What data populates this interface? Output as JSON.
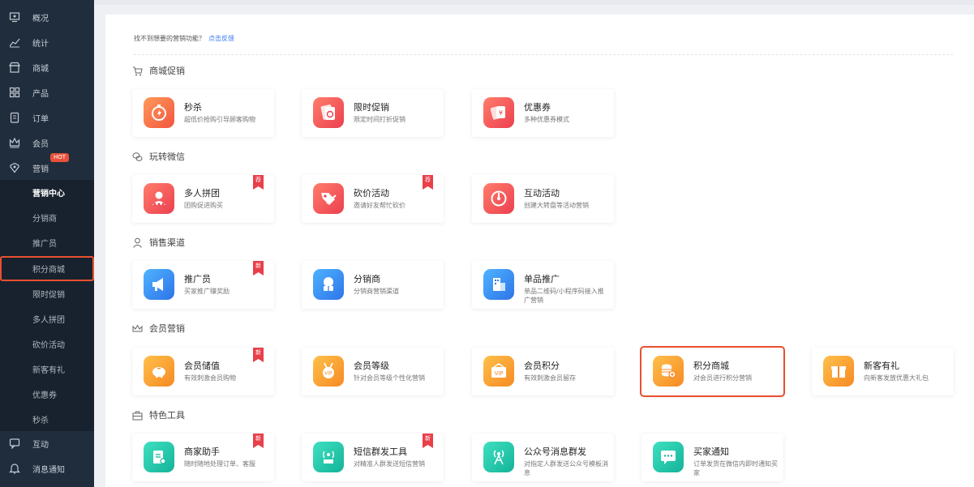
{
  "sidebar": {
    "items": [
      {
        "label": "概况",
        "icon": "dashboard-icon"
      },
      {
        "label": "统计",
        "icon": "chart-icon"
      },
      {
        "label": "商城",
        "icon": "store-icon"
      },
      {
        "label": "产品",
        "icon": "grid-icon"
      },
      {
        "label": "订单",
        "icon": "order-icon"
      },
      {
        "label": "会员",
        "icon": "crown-icon"
      },
      {
        "label": "营销",
        "icon": "marketing-icon"
      }
    ],
    "hot_badge": "HOT",
    "sub_items": [
      {
        "label": "营销中心"
      },
      {
        "label": "分销商"
      },
      {
        "label": "推广员"
      },
      {
        "label": "积分商城"
      },
      {
        "label": "限时促销"
      },
      {
        "label": "多人拼团"
      },
      {
        "label": "砍价活动"
      },
      {
        "label": "新客有礼"
      },
      {
        "label": "优惠券"
      },
      {
        "label": "秒杀"
      }
    ],
    "bottom_items": [
      {
        "label": "互动",
        "icon": "chat-icon"
      },
      {
        "label": "消息通知",
        "icon": "bell-icon"
      }
    ]
  },
  "feedback": {
    "text": "找不到想要的营销功能？",
    "link": "点击反馈"
  },
  "sections": [
    {
      "title": "商城促销",
      "cards": [
        {
          "title": "秒杀",
          "desc": "超低价抢购引导顾客购物"
        },
        {
          "title": "限时促销",
          "desc": "限定时间打折促销"
        },
        {
          "title": "优惠券",
          "desc": "多种优惠券模式"
        }
      ]
    },
    {
      "title": "玩转微信",
      "cards": [
        {
          "title": "多人拼团",
          "desc": "团购促进购买",
          "badge": "荐"
        },
        {
          "title": "砍价活动",
          "desc": "邀请好友帮忙砍价",
          "badge": "荐"
        },
        {
          "title": "互动活动",
          "desc": "创建大转盘等活动营销"
        }
      ]
    },
    {
      "title": "销售渠道",
      "cards": [
        {
          "title": "推广员",
          "desc": "买家推广赚奖励",
          "badge": "新"
        },
        {
          "title": "分销商",
          "desc": "分销商营销渠道"
        },
        {
          "title": "单品推广",
          "desc": "单品二维码/小程序码接入推广营销"
        }
      ]
    },
    {
      "title": "会员营销",
      "cards": [
        {
          "title": "会员储值",
          "desc": "有效刺激会员购物",
          "badge": "新"
        },
        {
          "title": "会员等级",
          "desc": "针对会员等级个性化营销"
        },
        {
          "title": "会员积分",
          "desc": "有效刺激会员留存"
        },
        {
          "title": "积分商城",
          "desc": "对会员进行积分营销"
        },
        {
          "title": "新客有礼",
          "desc": "向新客发放优惠大礼包"
        }
      ]
    },
    {
      "title": "特色工具",
      "cards": [
        {
          "title": "商家助手",
          "desc": "随时随地处理订单、客服",
          "badge": "新"
        },
        {
          "title": "短信群发工具",
          "desc": "对精准人群发送短信营销",
          "badge": "新"
        },
        {
          "title": "公众号消息群发",
          "desc": "对指定人群发送公众号模板消息"
        },
        {
          "title": "买家通知",
          "desc": "订单发货在微信内即时通知买家"
        }
      ]
    }
  ]
}
